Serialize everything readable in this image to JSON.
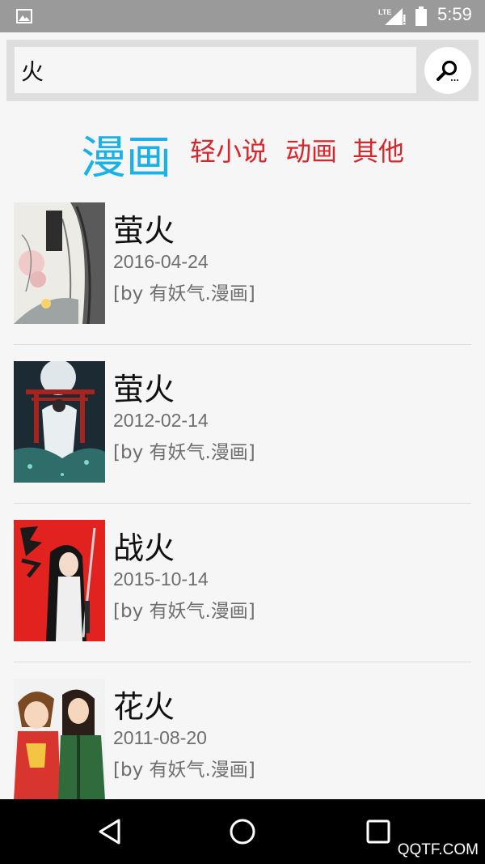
{
  "status_bar": {
    "time": "5:59",
    "icons": [
      "gallery-icon",
      "lte-signal-icon",
      "battery-icon"
    ]
  },
  "search": {
    "value": "火",
    "button_icon": "search-icon"
  },
  "tabs": [
    {
      "label": "漫画",
      "active": true
    },
    {
      "label": "轻小说",
      "active": false
    },
    {
      "label": "动画",
      "active": false
    },
    {
      "label": "其他",
      "active": false
    }
  ],
  "colors": {
    "active_tab": "#1ab0e8",
    "inactive_tab": "#d9262b",
    "status_bar": "#9a9a9a",
    "nav_bar": "#000000"
  },
  "results": [
    {
      "title": "萤火",
      "date": "2016-04-24",
      "source": "[by 有妖气.漫画]",
      "cover": "white-ink-cover"
    },
    {
      "title": "萤火",
      "date": "2012-02-14",
      "source": "[by 有妖气.漫画]",
      "cover": "night-torii-cover"
    },
    {
      "title": "战火",
      "date": "2015-10-14",
      "source": "[by 有妖气.漫画]",
      "cover": "red-swordsman-cover"
    },
    {
      "title": "花火",
      "date": "2011-08-20",
      "source": "[by 有妖气.漫画]",
      "cover": "two-characters-cover"
    }
  ],
  "nav_bar": {
    "icons": [
      "back-icon",
      "home-icon",
      "recents-icon"
    ],
    "watermark": "QQTF.COM"
  }
}
